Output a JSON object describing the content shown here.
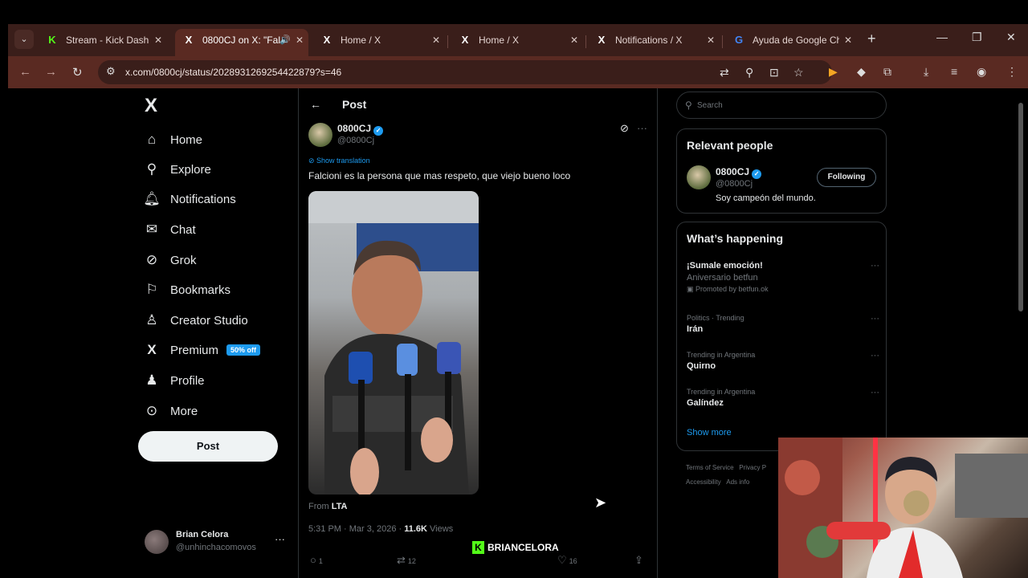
{
  "browser": {
    "tabs": [
      {
        "title": "Stream - Kick Dashbo",
        "favicon": "K",
        "favicon_color": "#53fc18",
        "active": false
      },
      {
        "title": "0800CJ on X: \"Fal",
        "favicon": "X",
        "favicon_color": "#ffffff",
        "active": true
      },
      {
        "title": "Home / X",
        "favicon": "X",
        "favicon_color": "#ffffff",
        "active": false
      },
      {
        "title": "Home / X",
        "favicon": "X",
        "favicon_color": "#ffffff",
        "active": false
      },
      {
        "title": "Notifications / X",
        "favicon": "X",
        "favicon_color": "#ffffff",
        "active": false
      },
      {
        "title": "Ayuda de Google Ch",
        "favicon": "G",
        "favicon_color": "#4285f4",
        "active": false
      }
    ],
    "url": "x.com/0800cj/status/2028931269254422879?s=46"
  },
  "sidebar": {
    "logo": "X",
    "items": [
      {
        "label": "Home",
        "icon": "home-icon",
        "glyph": "⌂"
      },
      {
        "label": "Explore",
        "icon": "search-icon",
        "glyph": "⚲"
      },
      {
        "label": "Notifications",
        "icon": "bell-icon",
        "glyph": "♫"
      },
      {
        "label": "Chat",
        "icon": "mail-icon",
        "glyph": "✉"
      },
      {
        "label": "Grok",
        "icon": "grok-icon",
        "glyph": "⊘"
      },
      {
        "label": "Bookmarks",
        "icon": "bookmark-icon",
        "glyph": "⎕"
      },
      {
        "label": "Creator Studio",
        "icon": "creator-icon",
        "glyph": "♙"
      },
      {
        "label": "Premium",
        "icon": "x-premium-icon",
        "glyph": "𝕏",
        "badge": "50% off"
      },
      {
        "label": "Profile",
        "icon": "person-icon",
        "glyph": "♙"
      },
      {
        "label": "More",
        "icon": "more-circle-icon",
        "glyph": "⊙"
      }
    ],
    "post_button": "Post",
    "account": {
      "name": "Brian Celora",
      "handle": "@unhinchacomovos"
    }
  },
  "main": {
    "header": "Post",
    "tweet": {
      "author": "0800CJ",
      "handle": "@0800Cj",
      "show_translation": "Show translation",
      "text": "Falcioni es la persona que mas respeto, que viejo bueno loco",
      "from_prefix": "From",
      "from_source": "LTA",
      "time": "5:31 PM · Mar 3, 2026 ·",
      "views_count": "11.6K",
      "views_label": "Views",
      "replies": "1",
      "reposts": "12",
      "likes": "16"
    },
    "overlay_brand": "BRIANCELORA"
  },
  "right": {
    "search_placeholder": "Search",
    "relevant": {
      "title": "Relevant people",
      "name": "0800CJ",
      "handle": "@0800Cj",
      "follow_label": "Following",
      "bio": "Soy campeón del mundo."
    },
    "happening": {
      "title": "What’s happening",
      "trends": [
        {
          "sub": "",
          "head": "¡Sumale emoción!",
          "extra": "Aniversario betfun",
          "promo": "Promoted by betfun.ok"
        },
        {
          "sub": "Politics · Trending",
          "head": "Irán"
        },
        {
          "sub": "Trending in Argentina",
          "head": "Quirno"
        },
        {
          "sub": "Trending in Argentina",
          "head": "Galíndez"
        }
      ],
      "show_more": "Show more"
    },
    "footer": [
      "Terms of Service",
      "Privacy P",
      "Accessibility",
      "Ads info"
    ]
  }
}
